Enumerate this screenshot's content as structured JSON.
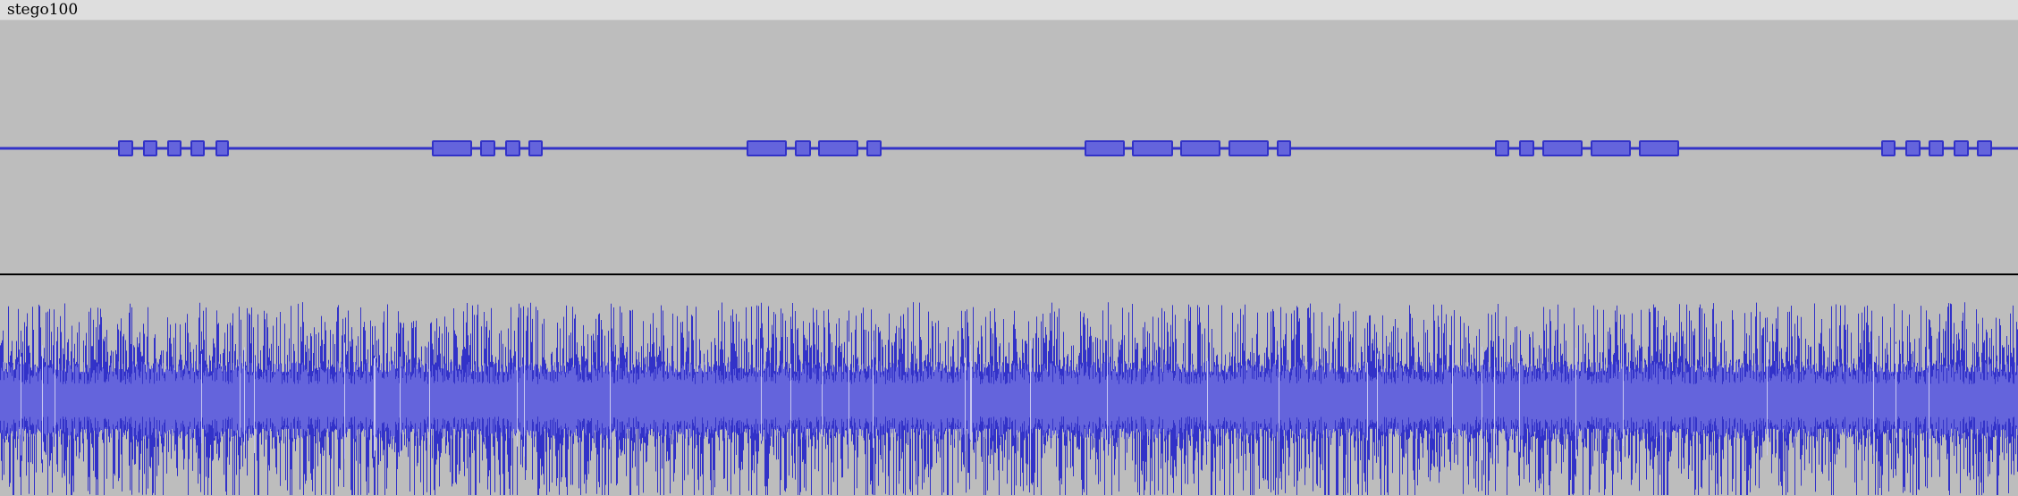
{
  "track": {
    "title": "stego100"
  },
  "colors": {
    "background": "#bdbdbd",
    "title_bar": "#dedede",
    "waveform_dark": "#3232c8",
    "waveform_light": "#6464dc",
    "separator": "#000000"
  }
}
